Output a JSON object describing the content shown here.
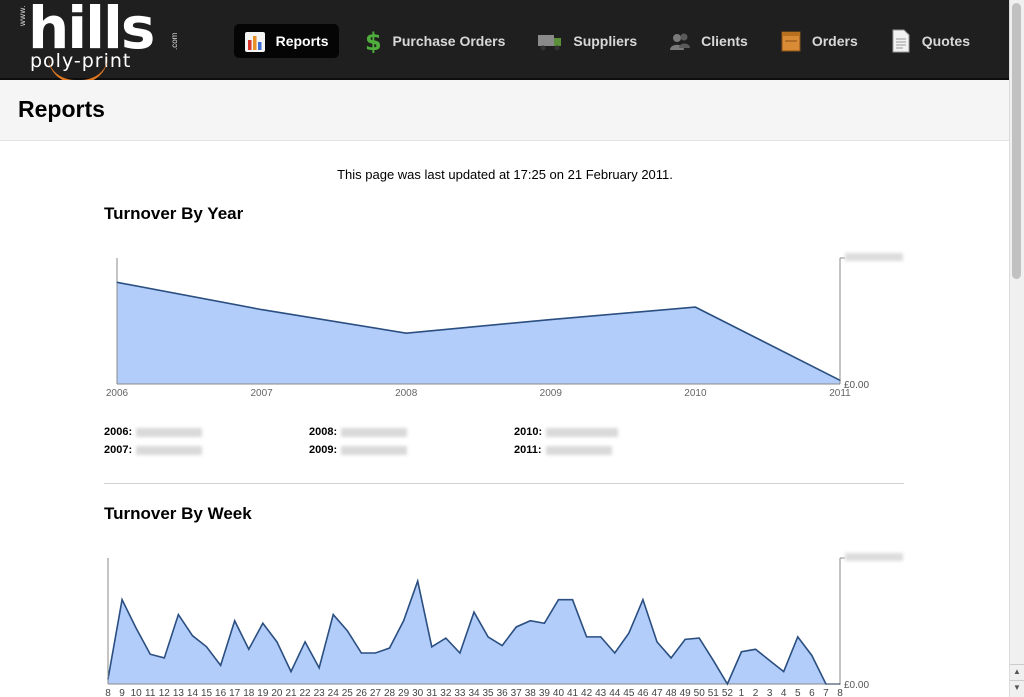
{
  "logo": {
    "www": "www.",
    "main": "hills",
    "sub": "poly-print",
    "com": ".com"
  },
  "nav": [
    {
      "label": "Reports",
      "icon": "bar-chart-icon",
      "active": true
    },
    {
      "label": "Purchase Orders",
      "icon": "dollar-icon",
      "active": false
    },
    {
      "label": "Suppliers",
      "icon": "truck-icon",
      "active": false
    },
    {
      "label": "Clients",
      "icon": "people-icon",
      "active": false
    },
    {
      "label": "Orders",
      "icon": "box-icon",
      "active": false
    },
    {
      "label": "Quotes",
      "icon": "document-icon",
      "active": false
    }
  ],
  "page": {
    "title": "Reports",
    "updated": "This page was last updated at 17:25 on 21 February 2011."
  },
  "sections": {
    "year_title": "Turnover By Year",
    "week_title": "Turnover By Week"
  },
  "year_values": [
    {
      "label": "2006:"
    },
    {
      "label": "2007:"
    },
    {
      "label": "2008:"
    },
    {
      "label": "2009:"
    },
    {
      "label": "2010:"
    },
    {
      "label": "2011:"
    }
  ],
  "colors": {
    "fill": "#b3cdfb",
    "line": "#2a4f80",
    "accent": "#e0761e"
  },
  "chart_data": [
    {
      "type": "area",
      "title": "Turnover By Year",
      "x": [
        "2006",
        "2007",
        "2008",
        "2009",
        "2010",
        "2011"
      ],
      "values": [
        0.82,
        0.6,
        0.41,
        0.52,
        0.62,
        0.03
      ],
      "values_note_unit": "fraction of obscured axis maximum",
      "y_min_label": "£0.00",
      "y_max_label_obscured": true,
      "ylim": [
        0,
        1
      ],
      "grid": false
    },
    {
      "type": "area",
      "title": "Turnover By Week",
      "x": [
        "8",
        "9",
        "10",
        "11",
        "12",
        "13",
        "14",
        "15",
        "16",
        "17",
        "18",
        "19",
        "20",
        "21",
        "22",
        "23",
        "24",
        "25",
        "26",
        "27",
        "28",
        "29",
        "30",
        "31",
        "32",
        "33",
        "34",
        "35",
        "36",
        "37",
        "38",
        "39",
        "40",
        "41",
        "42",
        "43",
        "44",
        "45",
        "46",
        "47",
        "48",
        "49",
        "50",
        "51",
        "52",
        "1",
        "2",
        "3",
        "4",
        "5",
        "6",
        "7",
        "8"
      ],
      "values": [
        0.04,
        0.68,
        0.45,
        0.24,
        0.21,
        0.56,
        0.39,
        0.3,
        0.15,
        0.51,
        0.28,
        0.49,
        0.34,
        0.1,
        0.34,
        0.13,
        0.56,
        0.43,
        0.25,
        0.25,
        0.29,
        0.51,
        0.83,
        0.3,
        0.37,
        0.25,
        0.58,
        0.38,
        0.31,
        0.46,
        0.51,
        0.49,
        0.68,
        0.68,
        0.38,
        0.38,
        0.25,
        0.41,
        0.68,
        0.34,
        0.21,
        0.36,
        0.37,
        0.19,
        0.0,
        0.26,
        0.28,
        0.19,
        0.1,
        0.38,
        0.23,
        0.0,
        0.0
      ],
      "values_note_unit": "fraction of obscured axis maximum",
      "y_min_label": "£0.00",
      "y_max_label_obscured": true,
      "ylim": [
        0,
        1
      ],
      "grid": false
    }
  ]
}
